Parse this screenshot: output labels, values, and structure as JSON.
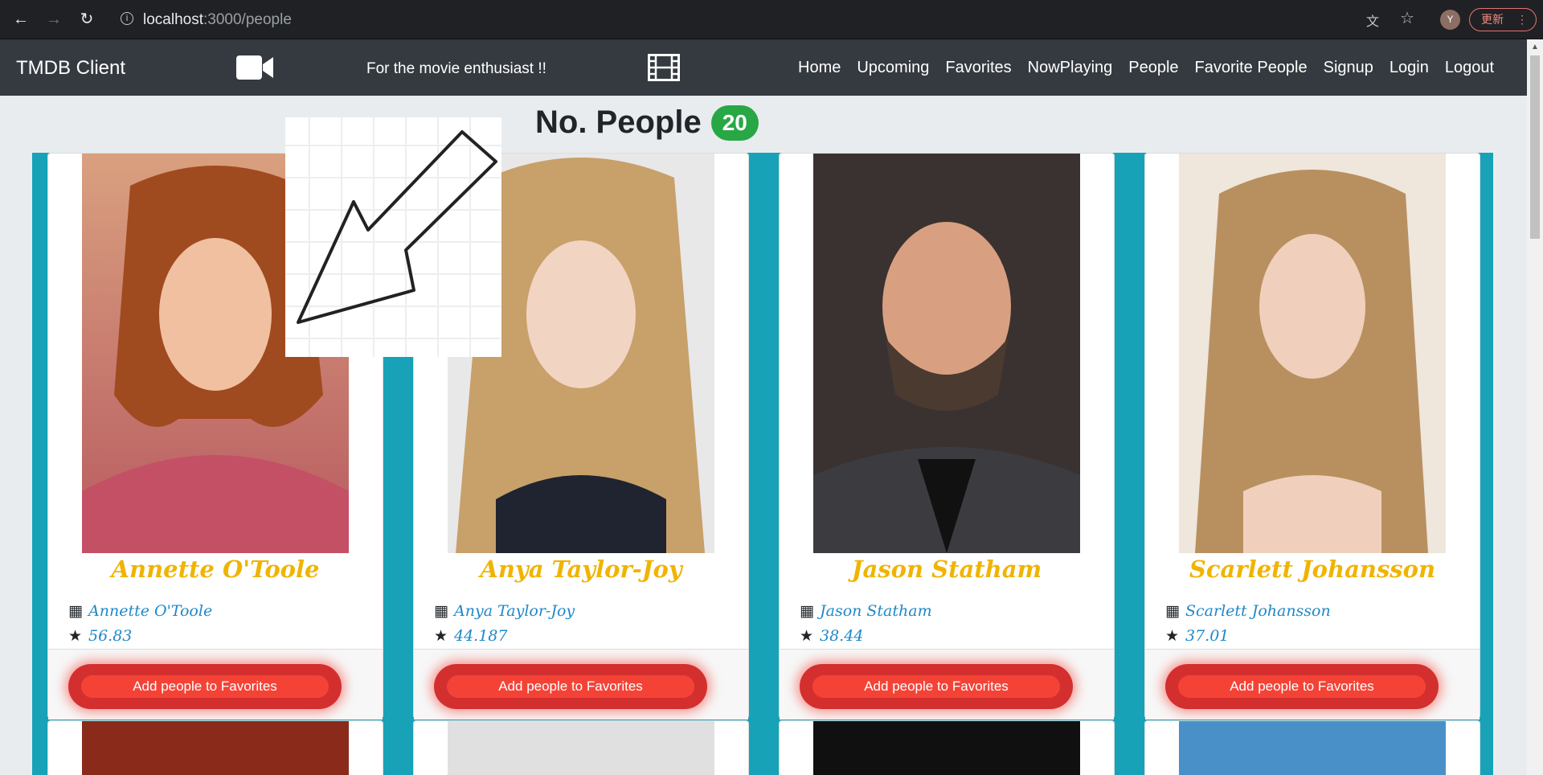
{
  "browser": {
    "url_host": "localhost",
    "url_path": ":3000/people",
    "avatar_letter": "Y",
    "update_label": "更新"
  },
  "navbar": {
    "brand": "TMDB Client",
    "tagline": "For the movie enthusiast !!",
    "links": [
      "Home",
      "Upcoming",
      "Favorites",
      "NowPlaying",
      "People",
      "Favorite People",
      "Signup",
      "Login",
      "Logout"
    ]
  },
  "page": {
    "title": "No. People",
    "count": "20"
  },
  "people": [
    {
      "name": "Annette O'Toole",
      "sub_name": "Annette O'Toole",
      "popularity": "56.83",
      "button": "Add people to Favorites"
    },
    {
      "name": "Anya Taylor-Joy",
      "sub_name": "Anya Taylor-Joy",
      "popularity": "44.187",
      "button": "Add people to Favorites"
    },
    {
      "name": "Jason Statham",
      "sub_name": "Jason Statham",
      "popularity": "38.44",
      "button": "Add people to Favorites"
    },
    {
      "name": "Scarlett Johansson",
      "sub_name": "Scarlett Johansson",
      "popularity": "37.01",
      "button": "Add people to Favorites"
    }
  ],
  "colors": {
    "navbar": "#343a40",
    "content_bg": "#17a2b8",
    "name": "#f0b400",
    "link": "#1e88c9",
    "badge": "#28a745",
    "button": "#f44336"
  }
}
